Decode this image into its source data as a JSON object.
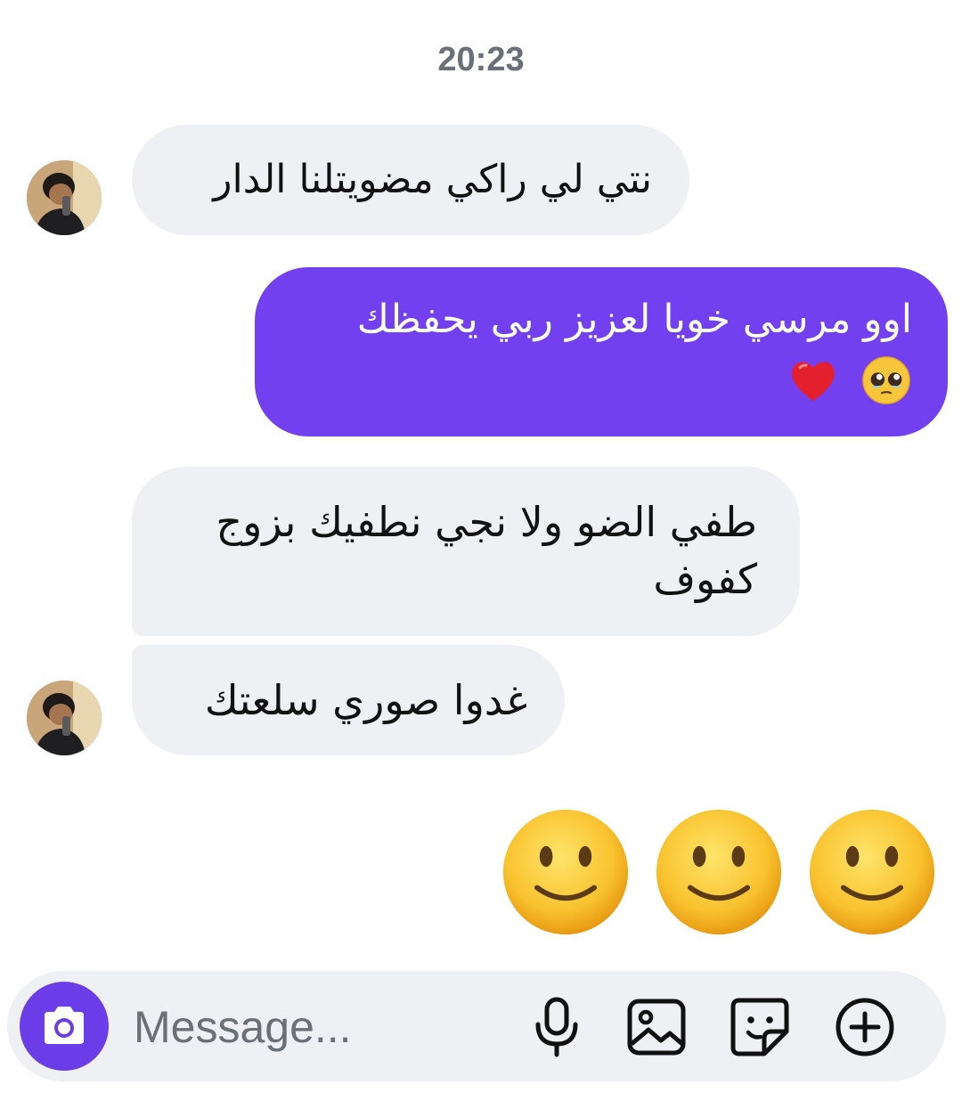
{
  "timestamp": "20:23",
  "messages": [
    {
      "direction": "incoming",
      "text": "نتي لي راكي مضويتلنا الدار"
    },
    {
      "direction": "outgoing",
      "text": "اوو مرسي خويا لعزيز ربي يحفظك",
      "emojis": [
        "pleading-face-icon",
        "red-heart-icon"
      ]
    },
    {
      "direction": "incoming",
      "text": "طفي الضو ولا نجي نطفيك بزوج كفوف"
    },
    {
      "direction": "incoming",
      "text": "غدوا صوري سلعتك"
    },
    {
      "direction": "outgoing",
      "emojis": [
        "slightly-smiling-face-icon",
        "slightly-smiling-face-icon",
        "slightly-smiling-face-icon"
      ]
    }
  ],
  "composer": {
    "placeholder": "Message...",
    "camera_icon": "camera-icon",
    "actions": [
      "microphone-icon",
      "image-icon",
      "sticker-icon",
      "plus-circle-icon"
    ]
  },
  "colors": {
    "outgoing_bubble": "#7340f0",
    "incoming_bubble": "#eff0f3",
    "camera_button": "#6a3de8",
    "timestamp": "#6b6f76"
  }
}
